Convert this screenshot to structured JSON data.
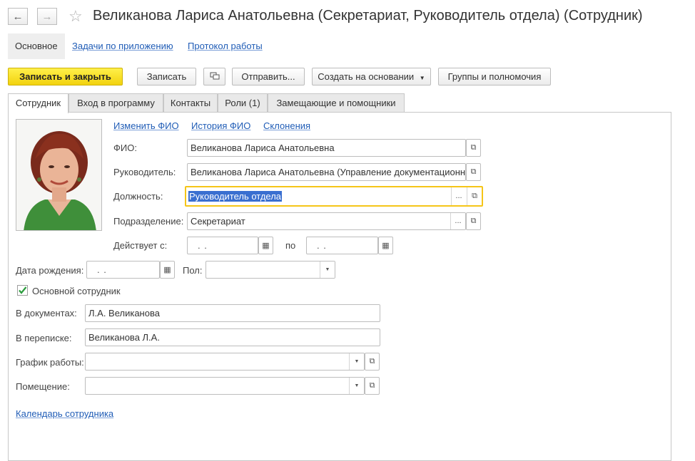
{
  "window": {
    "title": "Великанова Лариса Анатольевна (Секретариат, Руководитель отдела) (Сотрудник)"
  },
  "nav_panel": {
    "items": [
      {
        "label": "Основное"
      },
      {
        "label": "Задачи по приложению"
      },
      {
        "label": "Протокол работы"
      }
    ]
  },
  "toolbar": {
    "save_close": "Записать и закрыть",
    "save": "Записать",
    "send": "Отправить...",
    "create_based": "Создать на основании",
    "groups": "Группы и полномочия"
  },
  "tabs": [
    {
      "label": "Сотрудник"
    },
    {
      "label": "Вход в программу"
    },
    {
      "label": "Контакты"
    },
    {
      "label": "Роли (1)"
    },
    {
      "label": "Замещающие и помощники"
    }
  ],
  "links": {
    "change_fio": "Изменить ФИО",
    "history_fio": "История ФИО",
    "declension": "Склонения",
    "calendar": "Календарь сотрудника"
  },
  "form": {
    "fio_label": "ФИО:",
    "fio_value": "Великанова Лариса Анатольевна",
    "manager_label": "Руководитель:",
    "manager_value": "Великанова Лариса Анатольевна (Управление документационн",
    "position_label": "Должность:",
    "position_value": "Руководитель отдела",
    "department_label": "Подразделение:",
    "department_value": "Секретариат",
    "active_from_label": "Действует с:",
    "active_from_value": ".  .",
    "active_to_label": "по",
    "active_to_value": ".  .",
    "birth_label": "Дата рождения:",
    "birth_value": ".  .",
    "gender_label": "Пол:",
    "gender_value": "",
    "main_employee_label": "Основной сотрудник",
    "main_employee_checked": true,
    "in_docs_label": "В документах:",
    "in_docs_value": "Л.А. Великанова",
    "in_corr_label": "В переписке:",
    "in_corr_value": "Великанова Л.А.",
    "schedule_label": "График работы:",
    "schedule_value": "",
    "room_label": "Помещение:",
    "room_value": ""
  },
  "colors": {
    "primary_button": "#f5d90f",
    "link": "#1f5cb6",
    "focus_border": "#f5c518",
    "selection": "#3a6fd0"
  }
}
